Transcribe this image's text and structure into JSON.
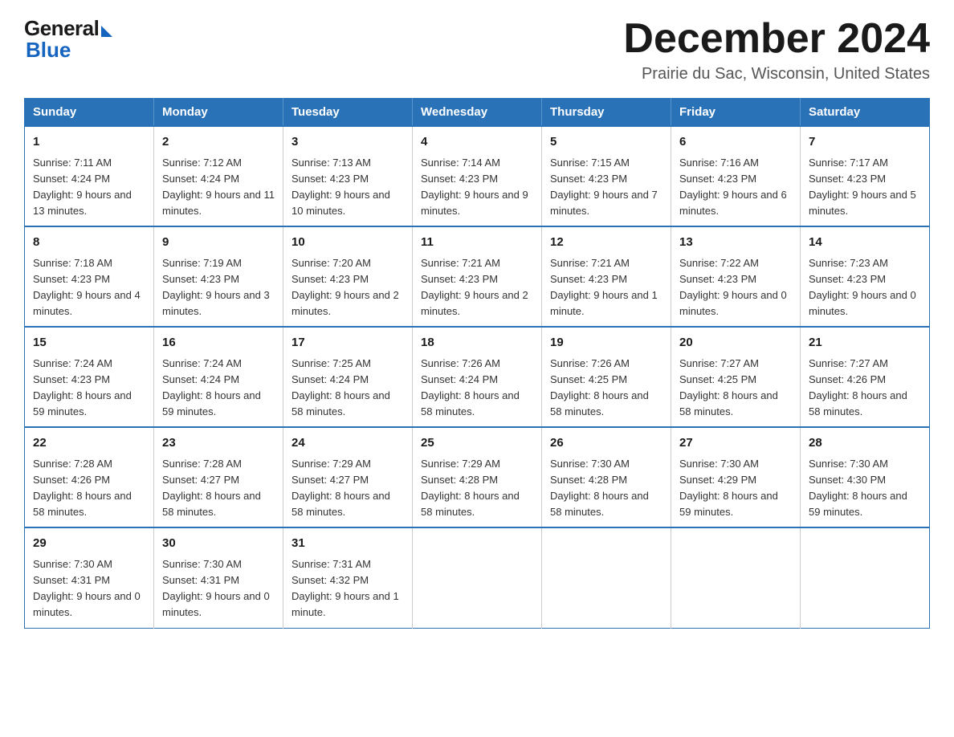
{
  "header": {
    "logo_general": "General",
    "logo_blue": "Blue",
    "month_title": "December 2024",
    "location": "Prairie du Sac, Wisconsin, United States"
  },
  "days_of_week": [
    "Sunday",
    "Monday",
    "Tuesday",
    "Wednesday",
    "Thursday",
    "Friday",
    "Saturday"
  ],
  "weeks": [
    [
      {
        "day": "1",
        "sunrise": "7:11 AM",
        "sunset": "4:24 PM",
        "daylight": "9 hours and 13 minutes."
      },
      {
        "day": "2",
        "sunrise": "7:12 AM",
        "sunset": "4:24 PM",
        "daylight": "9 hours and 11 minutes."
      },
      {
        "day": "3",
        "sunrise": "7:13 AM",
        "sunset": "4:23 PM",
        "daylight": "9 hours and 10 minutes."
      },
      {
        "day": "4",
        "sunrise": "7:14 AM",
        "sunset": "4:23 PM",
        "daylight": "9 hours and 9 minutes."
      },
      {
        "day": "5",
        "sunrise": "7:15 AM",
        "sunset": "4:23 PM",
        "daylight": "9 hours and 7 minutes."
      },
      {
        "day": "6",
        "sunrise": "7:16 AM",
        "sunset": "4:23 PM",
        "daylight": "9 hours and 6 minutes."
      },
      {
        "day": "7",
        "sunrise": "7:17 AM",
        "sunset": "4:23 PM",
        "daylight": "9 hours and 5 minutes."
      }
    ],
    [
      {
        "day": "8",
        "sunrise": "7:18 AM",
        "sunset": "4:23 PM",
        "daylight": "9 hours and 4 minutes."
      },
      {
        "day": "9",
        "sunrise": "7:19 AM",
        "sunset": "4:23 PM",
        "daylight": "9 hours and 3 minutes."
      },
      {
        "day": "10",
        "sunrise": "7:20 AM",
        "sunset": "4:23 PM",
        "daylight": "9 hours and 2 minutes."
      },
      {
        "day": "11",
        "sunrise": "7:21 AM",
        "sunset": "4:23 PM",
        "daylight": "9 hours and 2 minutes."
      },
      {
        "day": "12",
        "sunrise": "7:21 AM",
        "sunset": "4:23 PM",
        "daylight": "9 hours and 1 minute."
      },
      {
        "day": "13",
        "sunrise": "7:22 AM",
        "sunset": "4:23 PM",
        "daylight": "9 hours and 0 minutes."
      },
      {
        "day": "14",
        "sunrise": "7:23 AM",
        "sunset": "4:23 PM",
        "daylight": "9 hours and 0 minutes."
      }
    ],
    [
      {
        "day": "15",
        "sunrise": "7:24 AM",
        "sunset": "4:23 PM",
        "daylight": "8 hours and 59 minutes."
      },
      {
        "day": "16",
        "sunrise": "7:24 AM",
        "sunset": "4:24 PM",
        "daylight": "8 hours and 59 minutes."
      },
      {
        "day": "17",
        "sunrise": "7:25 AM",
        "sunset": "4:24 PM",
        "daylight": "8 hours and 58 minutes."
      },
      {
        "day": "18",
        "sunrise": "7:26 AM",
        "sunset": "4:24 PM",
        "daylight": "8 hours and 58 minutes."
      },
      {
        "day": "19",
        "sunrise": "7:26 AM",
        "sunset": "4:25 PM",
        "daylight": "8 hours and 58 minutes."
      },
      {
        "day": "20",
        "sunrise": "7:27 AM",
        "sunset": "4:25 PM",
        "daylight": "8 hours and 58 minutes."
      },
      {
        "day": "21",
        "sunrise": "7:27 AM",
        "sunset": "4:26 PM",
        "daylight": "8 hours and 58 minutes."
      }
    ],
    [
      {
        "day": "22",
        "sunrise": "7:28 AM",
        "sunset": "4:26 PM",
        "daylight": "8 hours and 58 minutes."
      },
      {
        "day": "23",
        "sunrise": "7:28 AM",
        "sunset": "4:27 PM",
        "daylight": "8 hours and 58 minutes."
      },
      {
        "day": "24",
        "sunrise": "7:29 AM",
        "sunset": "4:27 PM",
        "daylight": "8 hours and 58 minutes."
      },
      {
        "day": "25",
        "sunrise": "7:29 AM",
        "sunset": "4:28 PM",
        "daylight": "8 hours and 58 minutes."
      },
      {
        "day": "26",
        "sunrise": "7:30 AM",
        "sunset": "4:28 PM",
        "daylight": "8 hours and 58 minutes."
      },
      {
        "day": "27",
        "sunrise": "7:30 AM",
        "sunset": "4:29 PM",
        "daylight": "8 hours and 59 minutes."
      },
      {
        "day": "28",
        "sunrise": "7:30 AM",
        "sunset": "4:30 PM",
        "daylight": "8 hours and 59 minutes."
      }
    ],
    [
      {
        "day": "29",
        "sunrise": "7:30 AM",
        "sunset": "4:31 PM",
        "daylight": "9 hours and 0 minutes."
      },
      {
        "day": "30",
        "sunrise": "7:30 AM",
        "sunset": "4:31 PM",
        "daylight": "9 hours and 0 minutes."
      },
      {
        "day": "31",
        "sunrise": "7:31 AM",
        "sunset": "4:32 PM",
        "daylight": "9 hours and 1 minute."
      },
      null,
      null,
      null,
      null
    ]
  ]
}
